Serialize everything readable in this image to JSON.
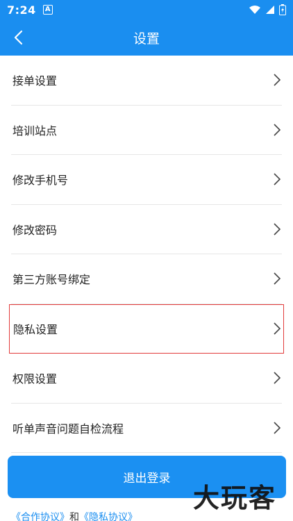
{
  "status_bar": {
    "time": "7:24",
    "badge": "A"
  },
  "app_bar": {
    "title": "设置"
  },
  "menu": [
    {
      "label": "接单设置"
    },
    {
      "label": "培训站点"
    },
    {
      "label": "修改手机号"
    },
    {
      "label": "修改密码"
    },
    {
      "label": "第三方账号绑定"
    },
    {
      "label": "隐私设置"
    },
    {
      "label": "权限设置"
    },
    {
      "label": "听单声音问题自检流程"
    }
  ],
  "logout": {
    "label": "退出登录"
  },
  "agreements": {
    "cooperation": "《合作协议》",
    "and": "和",
    "privacy": "《隐私协议》"
  },
  "watermark": {
    "text": "大玩客"
  },
  "colors": {
    "primary": "#1a8ef0",
    "highlight_border": "#e23a3a",
    "divider": "#e6e6e6"
  },
  "icons": [
    "back-arrow-icon",
    "wifi-icon",
    "signal-icon",
    "battery-icon",
    "chevron-right-icon"
  ]
}
